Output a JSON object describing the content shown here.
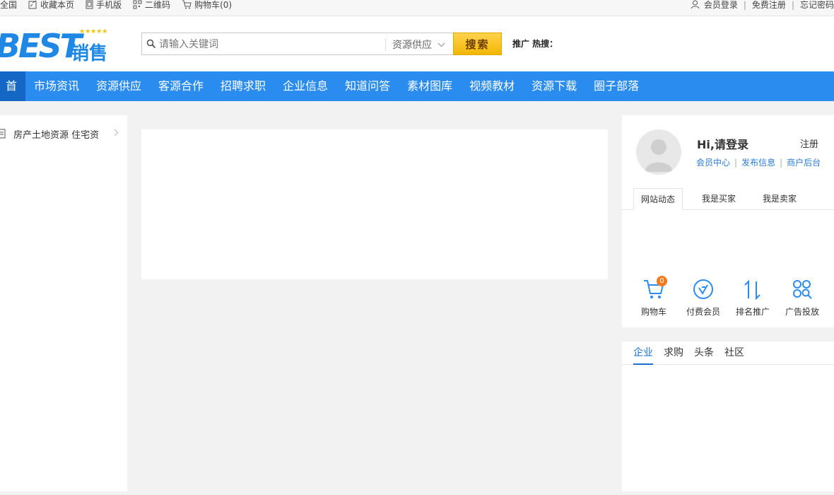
{
  "topbar": {
    "region": "全国",
    "bookmark": "收藏本页",
    "mobile": "手机版",
    "qrcode": "二维码",
    "cart": "购物车(0)",
    "login": "会员登录",
    "register": "免费注册",
    "forgot": "忘记密码"
  },
  "logo": {
    "text_en": "BEST",
    "text_cn": "销售",
    "stars": "★★★★★"
  },
  "search": {
    "placeholder": "请输入关键词",
    "category": "资源供应",
    "button": "搜索",
    "hot_label": "推广 热搜："
  },
  "nav": [
    "首页",
    "市场资讯",
    "资源供应",
    "客源合作",
    "招聘求职",
    "企业信息",
    "知道问答",
    "素材图库",
    "视频教材",
    "资源下载",
    "圈子部落"
  ],
  "sidebar": {
    "item": "房产土地资源 住宅资"
  },
  "user_panel": {
    "greeting": "Hi,请登录",
    "register": "注册",
    "links": [
      "会员中心",
      "发布信息",
      "商户后台"
    ],
    "tabs": [
      "网站动态",
      "我是买家",
      "我是卖家"
    ],
    "tools": [
      {
        "label": "购物车",
        "icon": "cart-icon",
        "badge": "0"
      },
      {
        "label": "付费会员",
        "icon": "vip-icon"
      },
      {
        "label": "排名推广",
        "icon": "rank-icon"
      },
      {
        "label": "广告投放",
        "icon": "ad-icon"
      }
    ]
  },
  "news_panel": {
    "tabs": [
      "企业",
      "求购",
      "头条",
      "社区"
    ]
  },
  "colors": {
    "primary": "#2b8cf0",
    "nav_active": "#1467c4",
    "search_button": "#f2b705",
    "badge": "#f47920"
  }
}
